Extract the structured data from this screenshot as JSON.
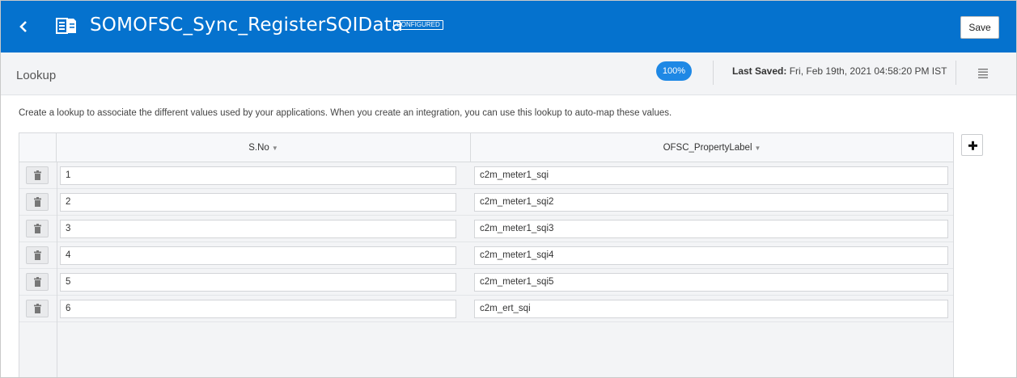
{
  "header": {
    "title": "SOMOFSC_Sync_RegisterSQIData",
    "status_badge": "CONFIGURED",
    "save_label": "Save",
    "back_icon": "chevron-left-icon",
    "doc_icon": "document-icon"
  },
  "toolbar": {
    "page_label": "Lookup",
    "progress": "100%",
    "last_saved_label": "Last Saved:",
    "last_saved_value": "Fri, Feb 19th, 2021 04:58:20 PM IST",
    "menu_icon": "hamburger-menu-icon"
  },
  "description": "Create a lookup to associate the different values used by your applications. When you create an integration, you can use this lookup to auto-map these values.",
  "table": {
    "columns": [
      "S.No",
      "OFSC_PropertyLabel"
    ],
    "rows": [
      {
        "sno": "1",
        "label": "c2m_meter1_sqi"
      },
      {
        "sno": "2",
        "label": "c2m_meter1_sqi2"
      },
      {
        "sno": "3",
        "label": "c2m_meter1_sqi3"
      },
      {
        "sno": "4",
        "label": "c2m_meter1_sqi4"
      },
      {
        "sno": "5",
        "label": "c2m_meter1_sqi5"
      },
      {
        "sno": "6",
        "label": "c2m_ert_sqi"
      }
    ]
  },
  "colors": {
    "header_bg": "#0572ce",
    "progress_bg": "#1e88e5"
  }
}
